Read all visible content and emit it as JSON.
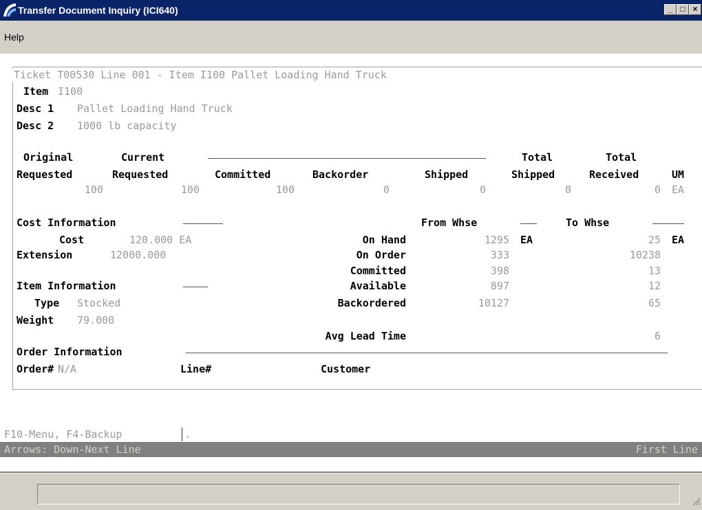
{
  "window": {
    "title": "Transfer Document Inquiry (ICI640)"
  },
  "menu": {
    "help": "Help"
  },
  "form": {
    "frame_title": "Ticket T00530 Line 001 - Item I100 Pallet Loading Hand Truck",
    "item_label": "Item",
    "item_value": "I100",
    "desc1_label": "Desc 1",
    "desc1_value": "Pallet Loading Hand Truck",
    "desc2_label": "Desc 2",
    "desc2_value": "1000 lb capacity",
    "qty_headers": {
      "original": "Original",
      "current_group": "Current",
      "total1": "Total",
      "total2": "Total",
      "requested1": "Requested",
      "requested2": "Requested",
      "committed": "Committed",
      "backorder": "Backorder",
      "shipped": "Shipped",
      "total_shipped": "Shipped",
      "total_received": "Received",
      "um": "UM"
    },
    "qty_values": {
      "original_requested": "100",
      "current_requested": "100",
      "committed": "100",
      "backorder": "0",
      "shipped": "0",
      "total_shipped": "0",
      "total_received": "0",
      "um": "EA"
    },
    "cost_section": "Cost Information",
    "cost_label": "Cost",
    "cost_value": "120.000 EA",
    "extension_label": "Extension",
    "extension_value": "12000.000",
    "item_section": "Item Information",
    "type_label": "Type",
    "type_value": "Stocked",
    "weight_label": "Weight",
    "weight_value": "79.000",
    "whse": {
      "from_header": "From Whse",
      "to_header": "To Whse",
      "rows": [
        {
          "label": "On Hand",
          "from": "1295",
          "from_um": "EA",
          "to": "25",
          "to_um": "EA"
        },
        {
          "label": "On Order",
          "from": "333",
          "to": "10238"
        },
        {
          "label": "Committed",
          "from": "398",
          "to": "13"
        },
        {
          "label": "Available",
          "from": "897",
          "to": "12"
        },
        {
          "label": "Backordered",
          "from": "10127",
          "to": "65"
        }
      ],
      "avg_lead_label": "Avg Lead Time",
      "avg_lead_to": "6"
    },
    "order_section": "Order Information",
    "order_label": "Order#",
    "order_value": "N/A",
    "line_label": "Line#",
    "customer_label": "Customer"
  },
  "footer": {
    "keys": "F10-Menu, F4-Backup",
    "status_left": "Arrows: Down-Next Line",
    "status_right": "First Line"
  },
  "colors": {
    "titlebar": "#0a246a",
    "chrome": "#d4d0c8",
    "value_text": "#9a9a9a",
    "status_bar": "#808080"
  }
}
